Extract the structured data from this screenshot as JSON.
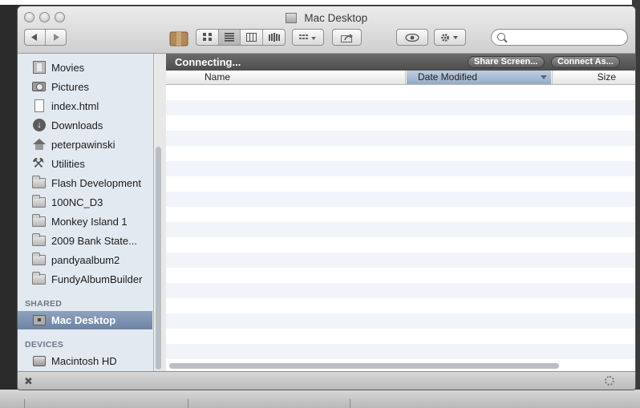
{
  "window": {
    "title": "Mac Desktop"
  },
  "toolbar": {
    "back_icon": "back-arrow-icon",
    "forward_icon": "forward-arrow-icon",
    "view_modes": [
      "icon-view",
      "list-view",
      "column-view",
      "cover-flow-view"
    ],
    "search_placeholder": ""
  },
  "sidebar": {
    "items": [
      {
        "label": "Movies",
        "icon": "movies-icon"
      },
      {
        "label": "Pictures",
        "icon": "pictures-icon"
      },
      {
        "label": "index.html",
        "icon": "document-icon"
      },
      {
        "label": "Downloads",
        "icon": "downloads-icon"
      },
      {
        "label": "peterpawinski",
        "icon": "home-icon"
      },
      {
        "label": "Utilities",
        "icon": "utilities-icon"
      },
      {
        "label": "Flash Development",
        "icon": "folder-icon"
      },
      {
        "label": "100NC_D3",
        "icon": "folder-icon"
      },
      {
        "label": "Monkey Island 1",
        "icon": "folder-icon"
      },
      {
        "label": "2009 Bank State...",
        "icon": "folder-icon"
      },
      {
        "label": "pandyaalbum2",
        "icon": "folder-icon"
      },
      {
        "label": "FundyAlbumBuilder",
        "icon": "folder-icon"
      }
    ],
    "shared_heading": "SHARED",
    "shared_items": [
      {
        "label": "Mac Desktop",
        "icon": "network-computer-icon",
        "selected": true
      }
    ],
    "devices_heading": "DEVICES",
    "device_items": [
      {
        "label": "Macintosh HD",
        "icon": "hard-disk-icon"
      }
    ]
  },
  "main": {
    "status_text": "Connecting...",
    "share_screen_label": "Share Screen...",
    "connect_as_label": "Connect As...",
    "columns": [
      {
        "label": "Name"
      },
      {
        "label": "Date Modified",
        "sorted": true
      },
      {
        "label": "Size"
      }
    ]
  },
  "colors": {
    "sidebar_bg": "#e3e9f0",
    "selection": "#7a8fae",
    "status_bar": "#5a5a5a"
  }
}
